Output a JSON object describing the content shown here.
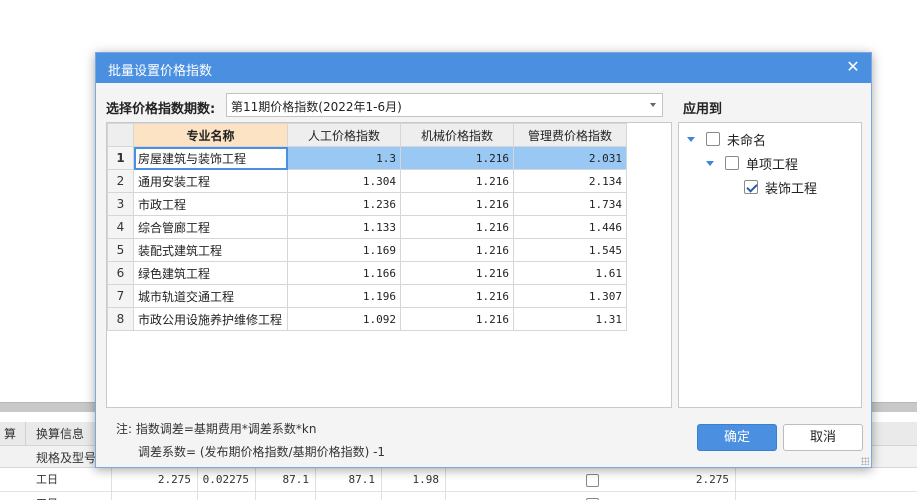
{
  "background": {
    "tabs": [
      "算",
      "换算信息"
    ],
    "header_label": "规格及型号",
    "rows": [
      [
        "工日",
        "",
        "2.275",
        "0.02275",
        "87.1",
        "87.1",
        "1.98",
        "",
        "",
        "2.275"
      ],
      [
        "工日",
        "",
        "",
        "",
        "",
        "",
        "",
        "",
        "",
        ""
      ]
    ]
  },
  "dialog": {
    "title": "批量设置价格指数",
    "period_label": "选择价格指数期数:",
    "period_value": "第11期价格指数(2022年1-6月)",
    "apply_label": "应用到",
    "columns": [
      "专业名称",
      "人工价格指数",
      "机械价格指数",
      "管理费价格指数"
    ],
    "rows": [
      {
        "idx": "1",
        "name": "房屋建筑与装饰工程",
        "labor": "1.3",
        "machine": "1.216",
        "mgmt": "2.031"
      },
      {
        "idx": "2",
        "name": "通用安装工程",
        "labor": "1.304",
        "machine": "1.216",
        "mgmt": "2.134"
      },
      {
        "idx": "3",
        "name": "市政工程",
        "labor": "1.236",
        "machine": "1.216",
        "mgmt": "1.734"
      },
      {
        "idx": "4",
        "name": "综合管廊工程",
        "labor": "1.133",
        "machine": "1.216",
        "mgmt": "1.446"
      },
      {
        "idx": "5",
        "name": "装配式建筑工程",
        "labor": "1.169",
        "machine": "1.216",
        "mgmt": "1.545"
      },
      {
        "idx": "6",
        "name": "绿色建筑工程",
        "labor": "1.166",
        "machine": "1.216",
        "mgmt": "1.61"
      },
      {
        "idx": "7",
        "name": "城市轨道交通工程",
        "labor": "1.196",
        "machine": "1.216",
        "mgmt": "1.307"
      },
      {
        "idx": "8",
        "name": "市政公用设施养护维修工程",
        "labor": "1.092",
        "machine": "1.216",
        "mgmt": "1.31"
      }
    ],
    "tree": [
      {
        "label": "未命名",
        "level": 0,
        "expandable": true,
        "checked": false
      },
      {
        "label": "单项工程",
        "level": 1,
        "expandable": true,
        "checked": false
      },
      {
        "label": "装饰工程",
        "level": 2,
        "expandable": false,
        "checked": true
      }
    ],
    "note_line1": "注: 指数调差=基期费用*调差系数*kn",
    "note_line2": "调差系数= (发布期价格指数/基期价格指数) -1",
    "ok_label": "确定",
    "cancel_label": "取消",
    "accent_color": "#4a8fe0",
    "selected_row": "1"
  }
}
